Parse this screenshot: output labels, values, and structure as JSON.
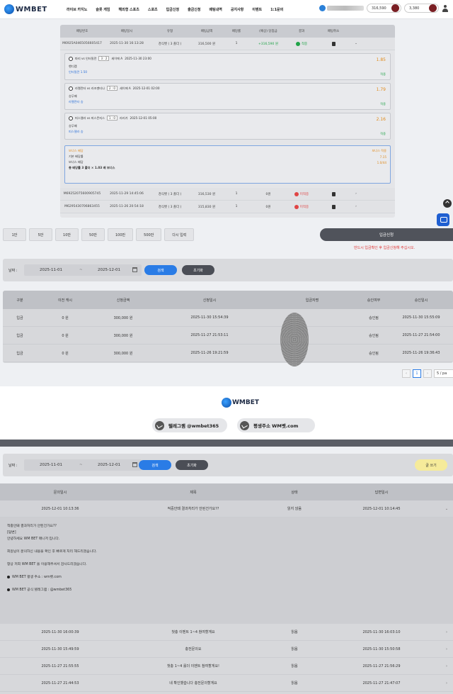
{
  "header": {
    "logo": "WMBET",
    "nav": [
      "라이브 카지노",
      "슬롯 게임",
      "해외형 스포츠",
      "스포츠",
      "입금신청",
      "출금신청",
      "배팅내역",
      "공지사항",
      "이벤트",
      "1:1문의"
    ],
    "balance_1": "316,590",
    "balance_2": "3,380"
  },
  "bet_history": {
    "columns": [
      "배팅번호",
      "배팅일시",
      "유형",
      "배팅금액",
      "배당률",
      "(예상) 당첨금",
      "결과",
      "배팅취소"
    ],
    "rows": [
      {
        "id": "M6925A0465056605417",
        "date": "2025-11-30 16:13:28",
        "type": "경식벳 ( 3 폴더 )",
        "amount": "316,500 원",
        "odds": "1",
        "win": "+316,590 원",
        "result": "적중",
        "result_kind": "win"
      },
      {
        "id": "M69252075600905745",
        "date": "2025-11-29 14:45:06",
        "type": "경식벳 ( 3 폴더 )",
        "amount": "316,530 원",
        "odds": "1",
        "win": "0원",
        "result": "미적중",
        "result_kind": "lose"
      },
      {
        "id": "M6295430706863455",
        "date": "2025-11-26 20:54:18",
        "type": "경식벳 ( 3 폴더 )",
        "amount": "315,830 원",
        "odds": "1",
        "win": "0원",
        "result": "미적중",
        "result_kind": "lose"
      }
    ],
    "matches": [
      {
        "teams": "파리 vs 인터밀란",
        "score": "3 : 2",
        "league": "세이에 A",
        "time": "2025-11-30 23:00",
        "market": "핸디캡",
        "pick": "인터밀란 1.50",
        "odds": "1.85",
        "status": "적중"
      },
      {
        "teams": "라멜란타 vs 라조멘티나",
        "score": "2 : 0",
        "league": "세이에 A",
        "time": "2025-12-01 02:00",
        "market": "승무패",
        "pick": "라멜란타 승",
        "odds": "1.79",
        "status": "적중"
      },
      {
        "teams": "피스델라 vs 피스몬지스",
        "score": "1 : 0",
        "league": "라리가",
        "time": "2025-12-01 05:00",
        "market": "승무패",
        "pick": "피스델라 승",
        "odds": "2.16",
        "status": "적중"
      }
    ],
    "summary": {
      "title": "보너스 배당",
      "title_right": "보너스 적용",
      "base_label": "기본 배당률",
      "base_value": "7.15",
      "bonus_label": "보너스 배당",
      "bonus_value": "1.0/44",
      "total_label": "총 배당률",
      "total_value": "3 폴더 × 1.03 배 보너스"
    }
  },
  "amounts": [
    "1만",
    "5만",
    "10만",
    "50만",
    "100만",
    "500만",
    "다시 입력"
  ],
  "deposit": {
    "button": "입금신청",
    "notice": "반드시 입금확인 후 입금신청해 주십시오.",
    "search_label": "날짜 :",
    "date_from": "2025-11-01",
    "date_sep": "~",
    "date_to": "2025-12-01",
    "search_btn": "검색",
    "reset_btn": "초기화",
    "columns": [
      "구분",
      "이전 캐시",
      "신청금액",
      "신청일시",
      "입금자명",
      "승인여부",
      "승인일시"
    ],
    "rows": [
      {
        "kind": "입금",
        "prev": "0 원",
        "amount": "300,000 원",
        "date": "2025-11-30 15:54:39",
        "status": "승인됨",
        "approved": "2025-11-30 15:55:09"
      },
      {
        "kind": "입금",
        "prev": "0 원",
        "amount": "300,000 원",
        "date": "2025-11-27 21:53:11",
        "status": "승인됨",
        "approved": "2025-11-27 21:54:00"
      },
      {
        "kind": "입금",
        "prev": "0 원",
        "amount": "300,000 원",
        "date": "2025-11-26 19:21:59",
        "status": "승인됨",
        "approved": "2025-11-26 19:36:43"
      }
    ],
    "page": "1",
    "page_size": "5 / pa"
  },
  "footer": {
    "logo": "WMBET",
    "telegram": "텔레그램 @wmbet365",
    "address": "평생주소 WM벳.com"
  },
  "inquiry": {
    "search_label": "날짜 :",
    "date_from": "2025-11-01",
    "date_sep": "~",
    "date_to": "2025-12-01",
    "search_btn": "검색",
    "reset_btn": "초기화",
    "write_btn": "글 쓰기",
    "columns": [
      "문의일시",
      "제목",
      "상태",
      "답변일시"
    ],
    "open_row": {
      "date": "2025-12-01 10:13:36",
      "title": "적중안돼 결과처리가 안된건가요??",
      "status": "읽지 않음",
      "answered": "2025-12-01 10:14:45"
    },
    "detail": [
      "적중안돼 결과처리가 안된건가요??",
      "[답변]",
      "안녕하세요 WM BET 매니저 입니다.",
      "",
      "회원님이 문의하신 내용을 확인 후 빠르게 처리 해드리겠습니다.",
      "",
      "항상 저희 WM BET 을 이용해주셔서 감사드리겠습니다.",
      ""
    ],
    "detail_bullets": [
      "WM BET 평생 주소 : wm벳.com",
      "WM BET 공식 텔레그램 : @wmbet365"
    ],
    "rows": [
      {
        "date": "2025-11-30 16:00:39",
        "title": "첫충 이벤트 1~4 참여할게요",
        "status": "읽음",
        "answered": "2025-11-30 16:03:10"
      },
      {
        "date": "2025-11-30 15:49:59",
        "title": "충전문의요",
        "status": "읽음",
        "answered": "2025-11-30 15:50:58"
      },
      {
        "date": "2025-11-27 21:55:55",
        "title": "첫충 1~4 롤더 이벤트 참여할게요!",
        "status": "읽음",
        "answered": "2025-11-27 21:56:29"
      },
      {
        "date": "2025-11-27 21:44:53",
        "title": "네 확인했습니다 충전문의할게요",
        "status": "읽음",
        "answered": "2025-11-27 21:47:07"
      }
    ]
  }
}
